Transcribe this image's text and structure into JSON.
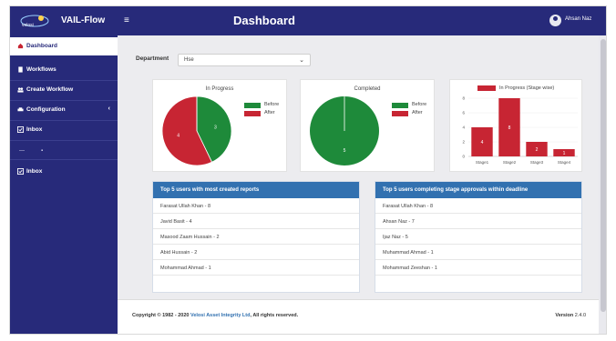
{
  "header": {
    "logo_text": "VAIL-Flow",
    "menu_toggle_glyph": "≡",
    "title": "Dashboard",
    "user_name": "Ahsan Naz"
  },
  "sidebar": {
    "items": [
      {
        "label": "Dashboard",
        "icon": "home-icon"
      },
      {
        "label": "Workflows",
        "icon": "file-icon"
      },
      {
        "label": "Create Workflow",
        "icon": "users-icon"
      },
      {
        "label": "Configuration",
        "icon": "car-icon"
      },
      {
        "label": "Inbox",
        "icon": "inbox-icon"
      },
      {
        "label": "Inbox",
        "icon": "inbox-icon"
      }
    ],
    "configuration_chevron": "‹",
    "small_markers": [
      "—",
      "▪"
    ]
  },
  "filter": {
    "department_label": "Department",
    "department_value": "Hse",
    "caret": "⌄"
  },
  "charts": {
    "in_progress": {
      "title": "In Progress"
    },
    "completed": {
      "title": "Completed"
    },
    "bar": {
      "legend": "In Progress (Stage wise)"
    }
  },
  "chart_data": [
    {
      "type": "pie",
      "title": "In Progress",
      "labels": [
        "Before",
        "After"
      ],
      "values": [
        3,
        4
      ],
      "colors": [
        "#1e8a3a",
        "#c72533"
      ]
    },
    {
      "type": "pie",
      "title": "Completed",
      "labels": [
        "Before",
        "After"
      ],
      "values": [
        5,
        0
      ],
      "colors": [
        "#1e8a3a",
        "#c72533"
      ]
    },
    {
      "type": "bar",
      "series": [
        {
          "name": "In Progress (Stage wise)",
          "values": [
            4,
            8,
            2,
            1
          ]
        }
      ],
      "categories": [
        "Stage1",
        "Stage2",
        "Stage3",
        "Stage4"
      ],
      "ylim": [
        0,
        8
      ],
      "yticks": [
        "0",
        "2",
        "4",
        "6",
        "8"
      ],
      "color": "#c72533"
    }
  ],
  "panels": {
    "left": {
      "heading": "Top 5 users with most created reports",
      "rows": [
        "Farasat Ullah Khan - 8",
        "Javid Basit - 4",
        "Masood Zaam Hussain - 2",
        "Abid Hussain - 2",
        "Mohammad Ahmad - 1"
      ]
    },
    "right": {
      "heading": "Top 5 users completing stage approvals within deadline",
      "rows": [
        "Farasat Ullah Khan - 8",
        "Ahsan Naz - 7",
        "Ijaz Naz - 5",
        "Muhammad Ahmad - 1",
        "Mohammad Zeeshan - 1"
      ]
    }
  },
  "footer": {
    "copyright_prefix": "Copyright © 1982 - 2020",
    "company": "Velosi Asset Integrity Ltd",
    "rights": ", All rights reserved.",
    "version_label": "Version",
    "version_value": "2.4.0"
  },
  "colors": {
    "navy": "#272a7a",
    "green": "#1e8a3a",
    "red": "#c72533",
    "panel_blue": "#3271b0"
  }
}
